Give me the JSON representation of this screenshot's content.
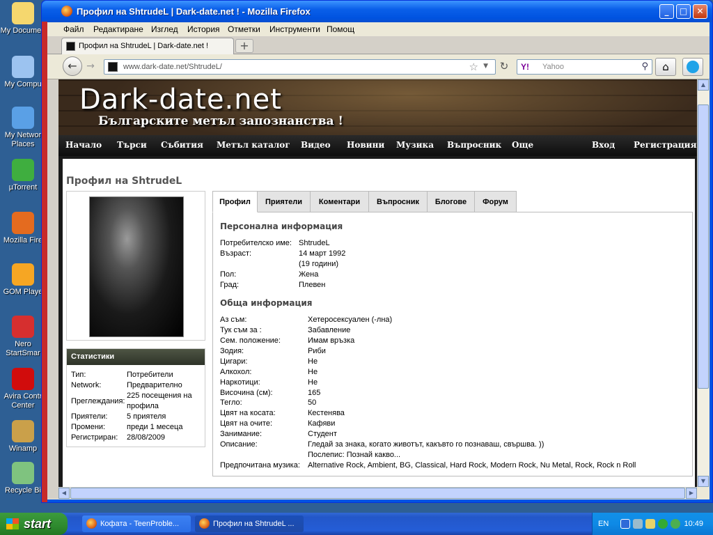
{
  "desktop": {
    "icons": [
      {
        "label": "My Documen",
        "color": "#f5d76e"
      },
      {
        "label": "My Compu",
        "color": "#9cc3f0"
      },
      {
        "label": "My Networ Places",
        "color": "#5aa0e6"
      },
      {
        "label": "µTorrent",
        "color": "#3fae3f"
      },
      {
        "label": "Mozilla Fire",
        "color": "#e46b1f"
      },
      {
        "label": "GOM Playe",
        "color": "#f6a623"
      },
      {
        "label": "Nero StartSmar",
        "color": "#d62f2f"
      },
      {
        "label": "Avira Contr Center",
        "color": "#d10c0c"
      },
      {
        "label": "Winamp",
        "color": "#caa04a"
      },
      {
        "label": "Recycle Bi",
        "color": "#7fc37f"
      }
    ]
  },
  "window": {
    "title": "Профил на ShtrudeL | Dark-date.net ! - Mozilla Firefox",
    "buttons": {
      "minimize": "_",
      "maximize": "□",
      "close": "✕"
    }
  },
  "menubar": {
    "items": [
      "Файл",
      "Редактиране",
      "Изглед",
      "История",
      "Отметки",
      "Инструменти",
      "Помощ"
    ]
  },
  "tabs": {
    "active_title": "Профил на ShtrudeL | Dark-date.net !",
    "new_tab": "+"
  },
  "navbar": {
    "back": "←",
    "forward": "→",
    "url_host": "www.dark-date.net",
    "url_domain": "dark-date.net",
    "url_path": "/ShtrudeL/",
    "reload": "↻",
    "search_engine": "Y!",
    "search_placeholder": "Yahoo",
    "home": "⌂"
  },
  "site": {
    "logo": "Dark-date.net",
    "tagline": "Българските метъл запознанства !",
    "nav": [
      "Начало",
      "Търси",
      "Събития",
      "Метъл каталог",
      "Видео",
      "Новини",
      "Музика",
      "Въпросник",
      "Още"
    ],
    "nav_right": [
      "Вход",
      "Регистрация"
    ]
  },
  "profile": {
    "title": "Профил на ShtrudeL",
    "stats_title": "Статистики",
    "stats": [
      {
        "k": "Тип:",
        "v": "Потребители"
      },
      {
        "k": "Network:",
        "v": "Предварително"
      },
      {
        "k": "Преглеждания:",
        "v": "225 посещения на профила"
      },
      {
        "k": "Приятели:",
        "v": "5 приятеля"
      },
      {
        "k": "Промени:",
        "v": "преди 1 месеца"
      },
      {
        "k": "Регистриран:",
        "v": "28/08/2009"
      }
    ],
    "tabs": [
      "Профил",
      "Приятели",
      "Коментари",
      "Въпросник",
      "Блогове",
      "Форум"
    ],
    "personal_title": "Персонална информация",
    "personal": [
      {
        "k": "Потребителско име:",
        "v": "ShtrudeL"
      },
      {
        "k": "Възраст:",
        "v": "14 март 1992"
      },
      {
        "k": "",
        "v": "(19 години)"
      },
      {
        "k": "Пол:",
        "v": "Жена"
      },
      {
        "k": "Град:",
        "v": "Плевен"
      }
    ],
    "general_title": "Обща информация",
    "general": [
      {
        "k": "Аз съм:",
        "v": "Хетеросексуален (-лна)"
      },
      {
        "k": "Тук съм за :",
        "v": "Забавление"
      },
      {
        "k": "Сем. положение:",
        "v": "Имам връзка"
      },
      {
        "k": "Зодия:",
        "v": "Риби"
      },
      {
        "k": "Цигари:",
        "v": "Не"
      },
      {
        "k": "Алкохол:",
        "v": "Не"
      },
      {
        "k": "Наркотици:",
        "v": "Не"
      },
      {
        "k": "Височина (см):",
        "v": "165"
      },
      {
        "k": "Тегло:",
        "v": "50"
      },
      {
        "k": "Цвят на косата:",
        "v": "Кестенява"
      },
      {
        "k": "Цвят на очите:",
        "v": "Кафяви"
      },
      {
        "k": "Занимание:",
        "v": "Студент"
      },
      {
        "k": "Описание:",
        "v": "Гледай за знака, когато животът, какъвто го познаваш, свършва. ))"
      },
      {
        "k": "",
        "v": "Послепис: Познай какво..."
      },
      {
        "k": "Предпочитана музика:",
        "v": "Alternative Rock, Ambient, BG, Classical, Hard Rock, Modern Rock, Nu Metal, Rock, Rock n Roll"
      }
    ]
  },
  "taskbar": {
    "start": "start",
    "tasks": [
      "Кофата - TeenProble...",
      "Профил на ShtrudeL ..."
    ],
    "lang": "EN",
    "clock": "10:49"
  }
}
